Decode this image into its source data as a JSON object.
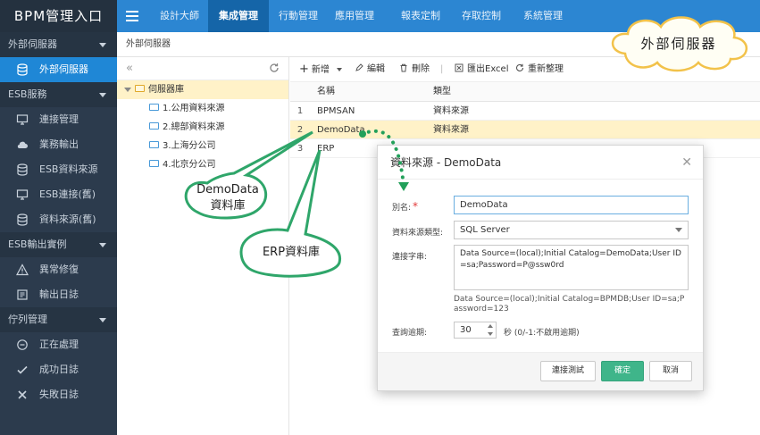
{
  "app": {
    "title": "BPM管理入口"
  },
  "sidebar": {
    "groups": [
      {
        "label": "外部伺服器",
        "items": [
          {
            "label": "外部伺服器",
            "icon": "database-icon",
            "active": true
          }
        ]
      },
      {
        "label": "ESB服務",
        "items": [
          {
            "label": "連接管理",
            "icon": "monitor-icon"
          },
          {
            "label": "業務輸出",
            "icon": "cloud-icon"
          },
          {
            "label": "ESB資料來源",
            "icon": "database-icon"
          },
          {
            "label": "ESB連接(舊)",
            "icon": "monitor-icon"
          },
          {
            "label": "資料來源(舊)",
            "icon": "database-icon"
          }
        ]
      },
      {
        "label": "ESB輸出實例",
        "items": [
          {
            "label": "異常修復",
            "icon": "warning-icon"
          },
          {
            "label": "輸出日誌",
            "icon": "log-icon"
          }
        ]
      },
      {
        "label": "佇列管理",
        "items": [
          {
            "label": "正在處理",
            "icon": "minus-circle-icon"
          },
          {
            "label": "成功日誌",
            "icon": "check-icon"
          },
          {
            "label": "失敗日誌",
            "icon": "x-icon"
          }
        ]
      }
    ]
  },
  "topnav": {
    "tabs": [
      {
        "label": "設計大師"
      },
      {
        "label": "集成管理",
        "active": true
      },
      {
        "label": "行動管理"
      },
      {
        "label": "應用管理"
      },
      {
        "label": "報表定制"
      },
      {
        "label": "存取控制"
      },
      {
        "label": "系統管理"
      }
    ]
  },
  "breadcrumb": "外部伺服器",
  "tree": {
    "root": "伺服器庫",
    "nodes": [
      "1.公用資料來源",
      "2.總部資料來源",
      "3.上海分公司",
      "4.北京分公司"
    ]
  },
  "toolbar": {
    "add": "新增",
    "edit": "編輯",
    "delete": "刪除",
    "export": "匯出Excel",
    "reload": "重新整理"
  },
  "grid": {
    "columns": {
      "name": "名稱",
      "type": "類型"
    },
    "rows": [
      {
        "num": "1",
        "name": "BPMSAN",
        "type": "資料來源"
      },
      {
        "num": "2",
        "name": "DemoData",
        "type": "資料來源",
        "selected": true
      },
      {
        "num": "3",
        "name": "ERP",
        "type": ""
      }
    ]
  },
  "dialog": {
    "title": "資料來源 - DemoData",
    "alias_label": "別名:",
    "alias_value": "DemoData",
    "type_label": "資料來源類型:",
    "type_value": "SQL Server",
    "conn_label": "連接字串:",
    "conn_value": "Data Source=(local);Initial Catalog=DemoData;User ID=sa;Password=P@ssw0rd",
    "conn_example": "Data Source=(local);Initial Catalog=BPMDB;User ID=sa;Password=123",
    "timeout_label": "查詢逾期:",
    "timeout_value": "30",
    "timeout_suffix": "秒 (0/-1:不啟用逾期)",
    "test_button": "連接測試",
    "ok_button": "確定",
    "cancel_button": "取消"
  },
  "callouts": {
    "cloud": "外部伺服器",
    "demodata_line1": "DemoData",
    "demodata_line2": "資料庫",
    "erp": "ERP資料庫"
  },
  "colors": {
    "sidebar_bg": "#2c3b4d",
    "topbar_bg": "#2c86d2",
    "active_blue": "#1f87d6",
    "selected_row": "#fff2c8",
    "primary_green": "#3fb58a",
    "callout_green": "#2fa66a"
  }
}
